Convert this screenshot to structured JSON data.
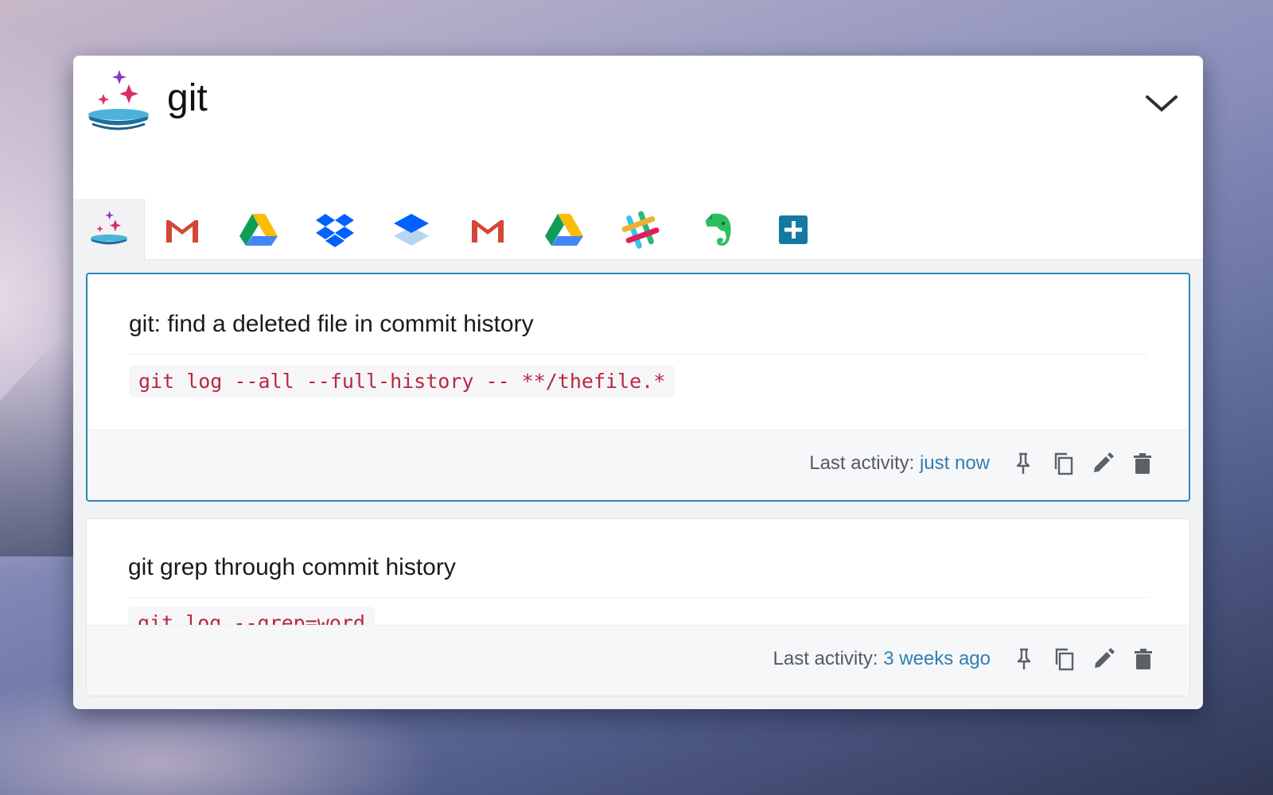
{
  "window": {
    "title": "git",
    "accent_color": "#2a86b8"
  },
  "header": {
    "logo_icon": "sparkle-bowl-icon",
    "collapse_icon": "chevron-down-icon"
  },
  "tabs": [
    {
      "icon": "sparkle-bowl-icon",
      "active": true
    },
    {
      "icon": "gmail-icon",
      "active": false
    },
    {
      "icon": "google-drive-icon",
      "active": false
    },
    {
      "icon": "dropbox-icon",
      "active": false
    },
    {
      "icon": "dropbox-paper-icon",
      "active": false
    },
    {
      "icon": "gmail-icon",
      "active": false
    },
    {
      "icon": "google-drive-icon",
      "active": false
    },
    {
      "icon": "slack-icon",
      "active": false
    },
    {
      "icon": "evernote-icon",
      "active": false
    },
    {
      "icon": "add-icon",
      "active": false
    }
  ],
  "snippets": [
    {
      "title": "git: find a deleted file in commit history",
      "code": "git log --all --full-history -- **/thefile.*",
      "activity_label": "Last activity: ",
      "activity_time": "just now",
      "selected": true
    },
    {
      "title": "git grep through commit history",
      "code": "git log --grep=word",
      "activity_label": "Last activity: ",
      "activity_time": "3 weeks ago",
      "selected": false
    }
  ],
  "actions": [
    "pin-icon",
    "copy-icon",
    "edit-icon",
    "delete-icon"
  ],
  "colors": {
    "code_text": "#b8273f",
    "activity_time": "#2f7fb3",
    "gmail_red": "#d44638",
    "evernote_green": "#2dbe60",
    "dropbox_blue": "#0061fe"
  }
}
